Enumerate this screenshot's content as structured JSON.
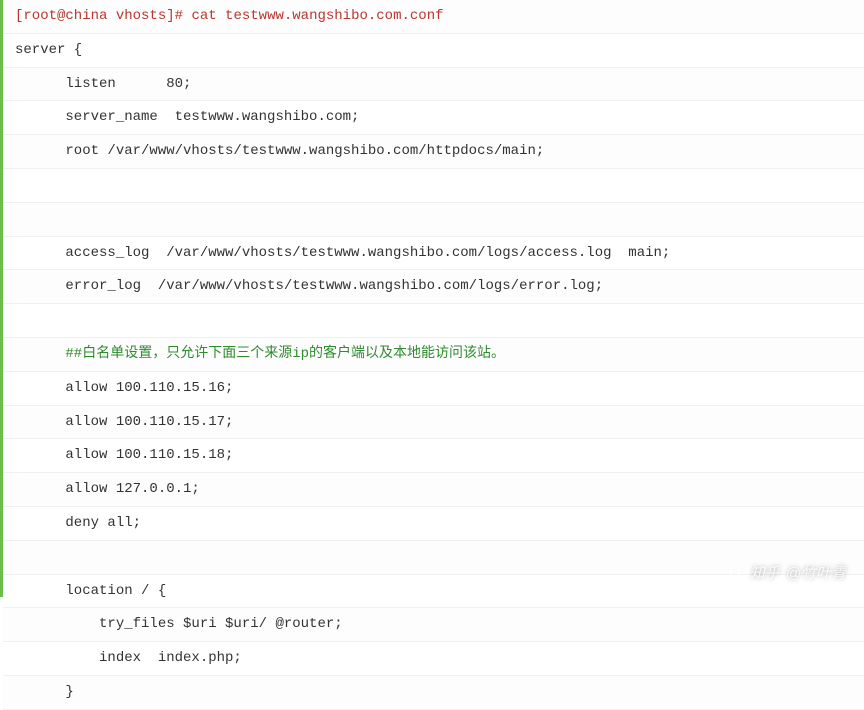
{
  "prompt": {
    "userHost": "[root@china vhosts]",
    "hash": "# ",
    "command": "cat testwww.wangshibo.com.conf"
  },
  "lines": {
    "l1": "server {",
    "l2": "      listen      80;",
    "l3": "      server_name  testwww.wangshibo.com;",
    "l4": "      root /var/www/vhosts/testwww.wangshibo.com/httpdocs/main;",
    "l5": "        ",
    "l6": "     ",
    "l7": "      access_log  /var/www/vhosts/testwww.wangshibo.com/logs/access.log  main;",
    "l8": "      error_log  /var/www/vhosts/testwww.wangshibo.com/logs/error.log;",
    "l9": " ",
    "l10_comment": "      ##白名单设置，只允许下面三个来源ip的客户端以及本地能访问该站。",
    "l11": "      allow 100.110.15.16;",
    "l12": "      allow 100.110.15.17;",
    "l13": "      allow 100.110.15.18;",
    "l14": "      allow 127.0.0.1;",
    "l15": "      deny all;",
    "l16": "       ",
    "l17": "      location / {",
    "l18": "          try_files $uri $uri/ @router;",
    "l19": "          index  index.php;",
    "l20": "      }"
  },
  "watermark": {
    "brand": "知乎",
    "author": "@竹叶青"
  }
}
